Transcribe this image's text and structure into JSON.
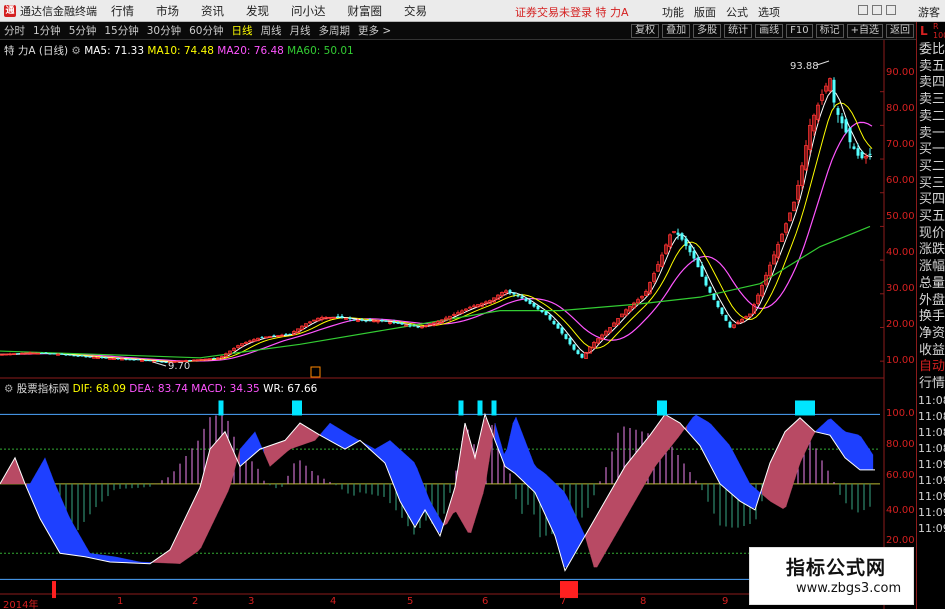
{
  "titlebar": {
    "app_name": "通达信金融终端",
    "menus": [
      "行情",
      "市场",
      "资讯",
      "发现",
      "问小达",
      "财富圈",
      "交易"
    ],
    "center_text": "证券交易未登录  特 力A",
    "right_menus": [
      "功能",
      "版面",
      "公式",
      "选项"
    ],
    "guest": "游客"
  },
  "periods": [
    "分时",
    "1分钟",
    "5分钟",
    "15分钟",
    "30分钟",
    "60分钟",
    "日线",
    "周线",
    "月线",
    "多周期",
    "更多"
  ],
  "period_active": "日线",
  "tools": [
    "复权",
    "叠加",
    "多股",
    "统计",
    "画线",
    "F10",
    "标记",
    "+自选",
    "返回"
  ],
  "main_info": {
    "name": "特 力A",
    "freq": "(日线)",
    "ma5": "MA5: 71.33",
    "ma10": "MA10: 74.48",
    "ma20": "MA20: 76.48",
    "ma60": "MA60: 50.01",
    "colors": {
      "ma5": "#ffffff",
      "ma10": "#ffff00",
      "ma20": "#ff55ff",
      "ma60": "#33cc33"
    }
  },
  "sub_info": {
    "name": "股票指标网",
    "dif": "DIF: 68.09",
    "dea": "DEA: 83.74",
    "macd": "MACD: 34.35",
    "wr": "WR: 67.66",
    "colors": {
      "dif": "#ffff00",
      "dea": "#ff55ff",
      "macd": "#ff55ff",
      "wr": "#ffffff"
    }
  },
  "price_axis": [
    "90.00",
    "80.00",
    "70.00",
    "60.00",
    "50.00",
    "40.00",
    "30.00",
    "20.00",
    "10.00"
  ],
  "ind_axis": [
    "100.0",
    "80.00",
    "60.00",
    "40.00",
    "20.00"
  ],
  "annotations": {
    "high": "93.88",
    "low": "9.70"
  },
  "x_axis": [
    "2014年",
    "1",
    "2",
    "3",
    "4",
    "5",
    "6",
    "7",
    "8",
    "9"
  ],
  "right_panel": {
    "lr": [
      "L",
      "R"
    ],
    "small": "100",
    "items": [
      "委比",
      "卖五",
      "卖四",
      "卖三",
      "卖二",
      "卖一",
      "买一",
      "买二",
      "买三",
      "买四",
      "买五",
      "现价",
      "涨跌",
      "涨幅",
      "总量",
      "外盘",
      "换手",
      "净资",
      "收益"
    ],
    "auto": "自动",
    "trades": "行情",
    "times": [
      "11:08",
      "11:08",
      "11:08",
      "11:08",
      "11:09",
      "11:09",
      "11:09",
      "11:09",
      "11:09"
    ]
  },
  "watermark": {
    "line1": "指标公式网",
    "line2": "www.zbgs3.com"
  },
  "chart_data": {
    "type": "candlestick",
    "price_ylim": [
      5,
      100
    ],
    "dates_axis": [
      "2014年",
      "1",
      "2",
      "3",
      "4",
      "5",
      "6",
      "7",
      "8",
      "9"
    ],
    "price_path": [
      [
        0,
        12
      ],
      [
        30,
        12.5
      ],
      [
        60,
        12
      ],
      [
        100,
        11
      ],
      [
        130,
        10.5
      ],
      [
        165,
        9.7
      ],
      [
        200,
        10.5
      ],
      [
        220,
        11
      ],
      [
        240,
        15
      ],
      [
        260,
        17
      ],
      [
        290,
        18
      ],
      [
        305,
        21
      ],
      [
        320,
        23
      ],
      [
        340,
        23
      ],
      [
        360,
        22
      ],
      [
        380,
        22
      ],
      [
        400,
        21
      ],
      [
        420,
        20
      ],
      [
        440,
        22
      ],
      [
        470,
        26
      ],
      [
        490,
        28
      ],
      [
        505,
        31
      ],
      [
        520,
        29
      ],
      [
        530,
        27
      ],
      [
        545,
        24
      ],
      [
        560,
        19
      ],
      [
        575,
        13
      ],
      [
        582,
        11
      ],
      [
        592,
        15
      ],
      [
        610,
        20
      ],
      [
        625,
        25
      ],
      [
        645,
        30
      ],
      [
        660,
        40
      ],
      [
        672,
        49
      ],
      [
        680,
        47
      ],
      [
        695,
        40
      ],
      [
        705,
        33
      ],
      [
        720,
        25
      ],
      [
        730,
        20
      ],
      [
        740,
        22
      ],
      [
        750,
        24
      ],
      [
        760,
        31
      ],
      [
        772,
        40
      ],
      [
        785,
        50
      ],
      [
        795,
        58
      ],
      [
        800,
        65
      ],
      [
        810,
        80
      ],
      [
        818,
        86
      ],
      [
        823,
        90
      ],
      [
        830,
        93.88
      ],
      [
        835,
        85
      ],
      [
        843,
        80
      ],
      [
        850,
        75
      ],
      [
        860,
        70
      ],
      [
        870,
        71.33
      ]
    ],
    "ma60_path": [
      [
        0,
        13
      ],
      [
        100,
        12
      ],
      [
        200,
        11
      ],
      [
        300,
        15
      ],
      [
        400,
        20
      ],
      [
        500,
        25
      ],
      [
        560,
        25
      ],
      [
        640,
        27
      ],
      [
        700,
        29
      ],
      [
        760,
        33
      ],
      [
        820,
        44
      ],
      [
        870,
        50
      ]
    ],
    "wr_ylim": [
      0,
      110
    ],
    "wr_path": [
      [
        0,
        60
      ],
      [
        15,
        75
      ],
      [
        25,
        60
      ],
      [
        40,
        40
      ],
      [
        60,
        20
      ],
      [
        85,
        18
      ],
      [
        110,
        15
      ],
      [
        150,
        14
      ],
      [
        170,
        22
      ],
      [
        185,
        40
      ],
      [
        200,
        58
      ],
      [
        210,
        80
      ],
      [
        225,
        90
      ],
      [
        240,
        70
      ],
      [
        260,
        80
      ],
      [
        285,
        85
      ],
      [
        300,
        95
      ],
      [
        320,
        88
      ],
      [
        345,
        80
      ],
      [
        360,
        85
      ],
      [
        385,
        72
      ],
      [
        400,
        50
      ],
      [
        415,
        35
      ],
      [
        425,
        45
      ],
      [
        440,
        30
      ],
      [
        455,
        58
      ],
      [
        465,
        95
      ],
      [
        475,
        75
      ],
      [
        485,
        100
      ],
      [
        495,
        85
      ],
      [
        505,
        70
      ],
      [
        515,
        66
      ],
      [
        535,
        55
      ],
      [
        555,
        30
      ],
      [
        565,
        10
      ],
      [
        580,
        25
      ],
      [
        600,
        45
      ],
      [
        625,
        70
      ],
      [
        650,
        88
      ],
      [
        665,
        100
      ],
      [
        680,
        95
      ],
      [
        700,
        82
      ],
      [
        720,
        60
      ],
      [
        740,
        50
      ],
      [
        755,
        45
      ],
      [
        770,
        72
      ],
      [
        785,
        90
      ],
      [
        800,
        98
      ],
      [
        815,
        90
      ],
      [
        830,
        88
      ],
      [
        845,
        75
      ],
      [
        860,
        68
      ],
      [
        875,
        68
      ]
    ]
  }
}
